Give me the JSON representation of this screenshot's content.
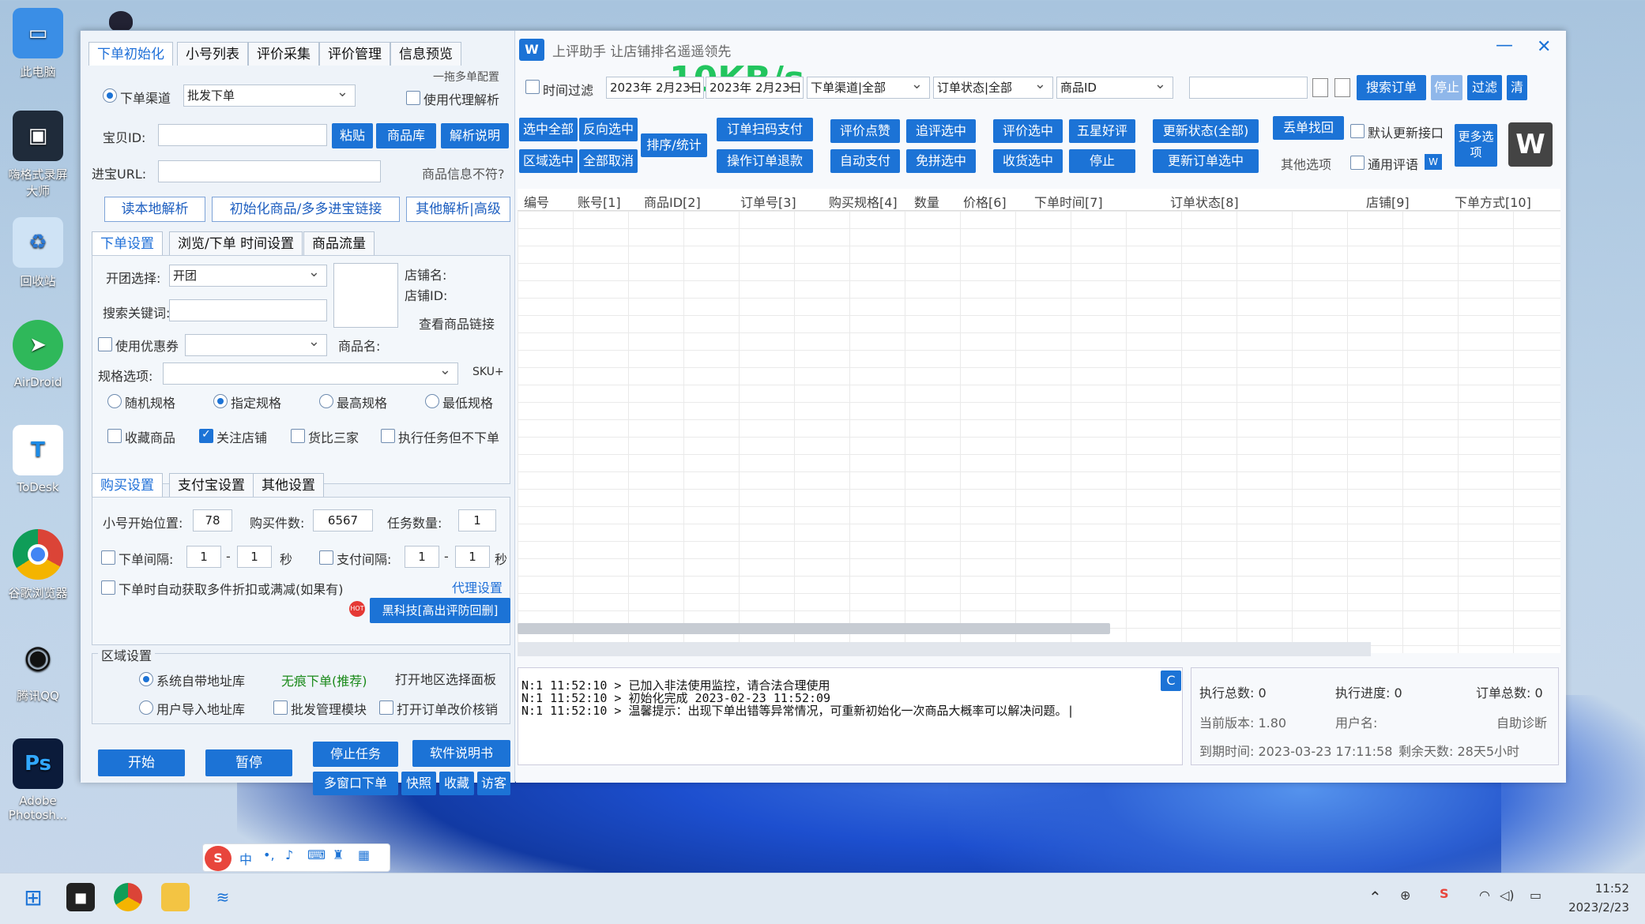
{
  "desktop": {
    "icons": [
      "此电脑",
      "嗨格式录屏大师",
      "回收站",
      "AirDroid",
      "ToDesk",
      "谷歌浏览器",
      "腾讯QQ",
      "Adobe Photosh..."
    ]
  },
  "window": {
    "title": "上评助手 让店铺排名遥遥领先",
    "speed_overlay": "10KB/s"
  },
  "left_tabs": [
    "下单初始化",
    "小号列表",
    "评价采集",
    "评价管理",
    "信息预览"
  ],
  "top_form": {
    "multi_config": "一拖多单配置",
    "channel_label": "下单渠道",
    "channel_value": "批发下单",
    "use_proxy": "使用代理解析",
    "item_id_label": "宝贝ID:",
    "paste_btn": "粘贴",
    "goods_lib_btn": "商品库",
    "parse_help_btn": "解析说明",
    "url_label": "进宝URL:",
    "info_mismatch": "商品信息不符?",
    "read_local": "读本地解析",
    "init_goods": "初始化商品/多多进宝链接",
    "other_parse": "其他解析|高级"
  },
  "order_tabs": [
    "下单设置",
    "浏览/下单 时间设置",
    "商品流量"
  ],
  "order_settings": {
    "group_label": "开团选择:",
    "group_value": "开团",
    "keyword_label": "搜索关键词:",
    "shop_name": "店铺名:",
    "shop_id": "店铺ID:",
    "view_link": "查看商品链接",
    "use_coupon": "使用优惠券",
    "goods_name": "商品名:",
    "spec_label": "规格选项:",
    "sku": "SKU+",
    "spec_radios": [
      "随机规格",
      "指定规格",
      "最高规格",
      "最低规格"
    ],
    "checks": [
      "收藏商品",
      "关注店铺",
      "货比三家",
      "执行任务但不下单"
    ]
  },
  "buy_tabs": [
    "购买设置",
    "支付宝设置",
    "其他设置"
  ],
  "buy_settings": {
    "start_pos_label": "小号开始位置:",
    "start_pos": "78",
    "count_label": "购买件数:",
    "count": "6567",
    "task_label": "任务数量:",
    "task": "1",
    "order_interval": "下单间隔:",
    "oi_a": "1",
    "oi_b": "1",
    "sec": "秒",
    "pay_interval": "支付间隔:",
    "pi_a": "1",
    "pi_b": "1",
    "auto_discount": "下单时自动获取多件折扣或满减(如果有)",
    "proxy_settings": "代理设置",
    "hot": "HOT",
    "black_tech": "黑科技[高出评防回删]"
  },
  "region": {
    "title": "区域设置",
    "sys_addr": "系统自带地址库",
    "no_trace": "无痕下单(推荐)",
    "open_region": "打开地区选择面板",
    "user_addr": "用户导入地址库",
    "batch_mgr": "批发管理模块",
    "open_edit": "打开订单改价核销"
  },
  "bottom_btns": {
    "start": "开始",
    "pause": "暂停",
    "stop_task": "停止任务",
    "manual": "软件说明书",
    "multi_win": "多窗口下单",
    "shortcut": "快照",
    "favorite": "收藏",
    "visitor": "访客"
  },
  "filter": {
    "time_filter": "时间过滤",
    "date_from": "2023年 2月23日",
    "date_to": "2023年 2月23日",
    "channel": "下单渠道|全部",
    "status": "订单状态|全部",
    "goods_id": "商品ID",
    "search_order": "搜索订单",
    "stop": "停止",
    "filter": "过滤",
    "clear": "清"
  },
  "actions": {
    "row1": [
      "选中全部",
      "反向选中",
      "订单扫码支付",
      "评价点赞",
      "追评选中",
      "评价选中",
      "五星好评",
      "更新状态(全部)",
      "丢单找回"
    ],
    "row2": [
      "区域选中",
      "全部取消",
      "操作订单退款",
      "自动支付",
      "免拼选中",
      "收货选中",
      "停止",
      "更新订单选中"
    ],
    "sort": "排序/统计",
    "default_update": "默认更新接口",
    "other_options": "其他选项",
    "general_review": "通用评语",
    "more": "更多选项"
  },
  "columns": [
    "编号",
    "账号[1]",
    "商品ID[2]",
    "订单号[3]",
    "购买规格[4]",
    "数量",
    "价格[6]",
    "下单时间[7]",
    "订单状态[8]",
    "店铺[9]",
    "下单方式[10]"
  ],
  "log": [
    "N:1 11:52:10 > 已加入非法使用监控，请合法合理使用",
    "N:1 11:52:10 > 初始化完成 2023-02-23 11:52:09",
    "N:1 11:52:10 > 温馨提示：出现下单出错等异常情况，可重新初始化一次商品大概率可以解决问题。|"
  ],
  "log_btn": "C",
  "stats": {
    "total_exec": "执行总数: 0",
    "progress": "执行进度: 0",
    "orders_total": "订单总数: 0",
    "version": "当前版本: 1.80",
    "username": "用户名:",
    "self_diag": "自助诊断",
    "expire": "到期时间: 2023-03-23 17:11:58",
    "remaining": "剩余天数: 28天5小时"
  },
  "taskbar": {
    "time": "11:52",
    "date": "2023/2/23",
    "ime": "中"
  }
}
